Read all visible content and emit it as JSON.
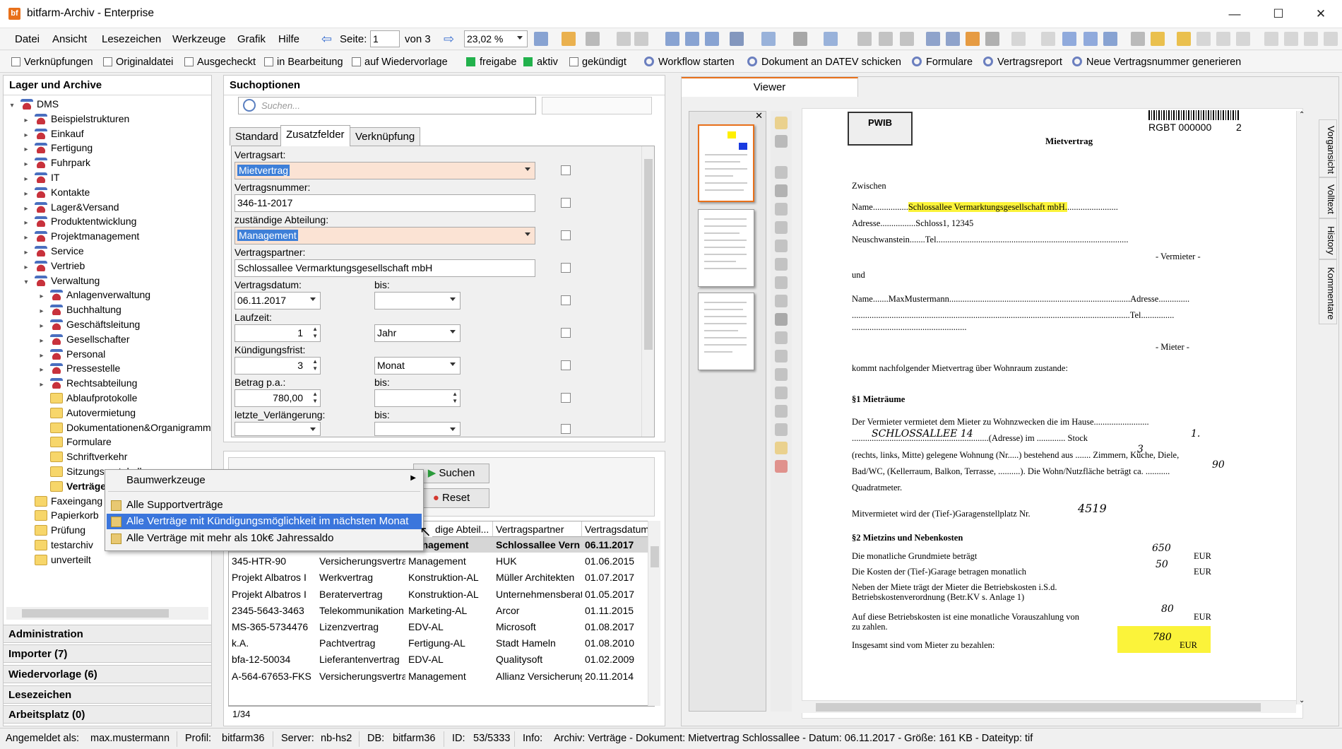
{
  "window": {
    "title": "bitfarm-Archiv - Enterprise",
    "app_icon": "bf"
  },
  "menu": [
    "Datei",
    "Ansicht",
    "Lesezeichen",
    "Werkzeuge",
    "Grafik",
    "Hilfe"
  ],
  "nav": {
    "page_label": "Seite:",
    "page_value": "1",
    "of_label": "von 3",
    "zoom": "23,02 %"
  },
  "filters": {
    "checks": [
      "Verknüpfungen",
      "Originaldatei",
      "Ausgecheckt",
      "in Bearbeitung",
      "auf Wiedervorlage"
    ],
    "status": [
      "freigabe",
      "aktiv"
    ],
    "gekuendigt": "gekündigt",
    "actions": [
      "Workflow starten",
      "Dokument an DATEV schicken",
      "Formulare",
      "Vertragsreport",
      "Neue Vertragsnummer generieren"
    ]
  },
  "left": {
    "header": "Lager und Archive",
    "root": "DMS",
    "top_items": [
      "Beispielstrukturen",
      "Einkauf",
      "Fertigung",
      "Fuhrpark",
      "IT",
      "Kontakte",
      "Lager&Versand",
      "Produktentwicklung",
      "Projektmanagement",
      "Service",
      "Vertrieb",
      "Verwaltung"
    ],
    "verwaltung_red": [
      "Anlagenverwaltung",
      "Buchhaltung",
      "Geschäftsleitung",
      "Gesellschafter",
      "Personal",
      "Pressestelle",
      "Rechtsabteilung"
    ],
    "verwaltung_yellow": [
      "Ablaufprotokolle",
      "Autovermietung",
      "Dokumentationen&Organigramm",
      "Formulare",
      "Schriftverkehr",
      "Sitzungsprotokolle",
      "Verträge"
    ],
    "bottom_items": [
      "Faxeingang",
      "Papierkorb",
      "Prüfung",
      "testarchiv",
      "unverteilt"
    ],
    "accordion": [
      "Administration",
      "Importer (7)",
      "Wiedervorlage (6)",
      "Lesezeichen",
      "Arbeitsplatz (0)"
    ]
  },
  "search": {
    "header": "Suchoptionen",
    "placeholder": "Suchen...",
    "tabs": [
      "Standard",
      "Zusatzfelder",
      "Verknüpfung"
    ],
    "fields": {
      "vertragsart_label": "Vertragsart:",
      "vertragsart": "Mietvertrag",
      "vertragsnummer_label": "Vertragsnummer:",
      "vertragsnummer": "346-11-2017",
      "abteilung_label": "zuständige Abteilung:",
      "abteilung": "Management",
      "partner_label": "Vertragspartner:",
      "partner": "Schlossallee Vermarktungsgesellschaft mbH",
      "datum_label": "Vertragsdatum:",
      "datum": "06.11.2017",
      "bis": "bis:",
      "laufzeit_label": "Laufzeit:",
      "laufzeit": "1",
      "laufzeit_unit": "Jahr",
      "kuendigung_label": "Kündigungsfrist:",
      "kuendigung": "3",
      "kuendigung_unit": "Monat",
      "betrag_label": "Betrag p.a.:",
      "betrag": "780,00",
      "verlaengerung_label": "letzte_Verlängerung:"
    },
    "buttons": {
      "search": "Suchen",
      "reset": "Reset"
    }
  },
  "results": {
    "headers": [
      "dige Abteil...",
      "Vertragspartner",
      "Vertragsdatum"
    ],
    "rows": [
      [
        "",
        "",
        "Management",
        "Schlossallee Vern",
        "06.11.2017"
      ],
      [
        "345-HTR-90",
        "Versicherungsvertra",
        "Management",
        "HUK",
        "01.06.2015"
      ],
      [
        "Projekt Albatros I",
        "Werkvertrag",
        "Konstruktion-AL",
        "Müller Architekten",
        "01.07.2017"
      ],
      [
        "Projekt Albatros I",
        "Beratervertrag",
        "Konstruktion-AL",
        "Unternehmensberat",
        "01.05.2017"
      ],
      [
        "2345-5643-3463",
        "Telekommunikation",
        "Marketing-AL",
        "Arcor",
        "01.11.2015"
      ],
      [
        "MS-365-5734476",
        "Lizenzvertrag",
        "EDV-AL",
        "Microsoft",
        "01.08.2017"
      ],
      [
        "k.A.",
        "Pachtvertrag",
        "Fertigung-AL",
        "Stadt Hameln",
        "01.08.2010"
      ],
      [
        "bfa-12-50034",
        "Lieferantenvertrag",
        "EDV-AL",
        "Qualitysoft",
        "01.02.2009"
      ],
      [
        "A-564-67653-FKS",
        "Versicherungsvertra",
        "Management",
        "Allianz Versicherungs",
        "20.11.2014"
      ]
    ],
    "count": "1/34"
  },
  "context_menu": {
    "tools": "Baumwerkzeuge",
    "items": [
      "Alle Supportverträge",
      "Alle Verträge mit Kündigungsmöglichkeit im nächsten Monat",
      "Alle Verträge mit mehr als 10k€ Jahressaldo"
    ]
  },
  "viewer": {
    "tab": "Viewer",
    "side_tabs": [
      "Vorgansicht",
      "Volltext",
      "History",
      "Kommentare"
    ],
    "doc": {
      "logo": "PWIB",
      "code": "RGBT 000000",
      "page_no": "2",
      "title": "Mietvertrag",
      "zwischen": "Zwischen",
      "name1_label": "Name................",
      "name1": "Schlossallee Vermarktungsgesellschaft mbH.",
      "adresse1": "Adresse................Schloss1, 12345",
      "ort1": "Neuschwanstein.......Tel.......................................................................................",
      "vermieter": "- Vermieter -",
      "und": "und",
      "name2": "Name.......MaxMustermann..................................................................................Adresse..............",
      "line2": "..............................................................................................................................Tel...............",
      "line3": "....................................................",
      "mieter": "- Mieter -",
      "intro": "kommt nachfolgender Mietvertrag über Wohnraum zustande:",
      "s1": "§1 Mieträume",
      "s1a": "Der  Vermieter  vermietet  dem  Mieter  zu  Wohnzwecken     die  im  Hause.........................",
      "s1b": "..............................................................(Adresse)   im   .............   Stock",
      "s1c": "(rechts, links, Mitte) gelegene Wohnung (Nr.....) bestehend aus .......  Zimmern, Küche, Diele,",
      "s1d": "Bad/WC, (Kellerraum, Balkon, Terrasse, ..........). Die Wohn/Nutzfläche beträgt ca. ...........",
      "s1e": "Quadratmeter.",
      "garage": "Mitvermietet wird der (Tief-)Garagenstellplatz Nr.",
      "hw_addr": "SCHLOSSALLEE 14",
      "hw_floor": "1.",
      "hw_rooms": "3",
      "hw_area": "90",
      "hw_garage": "4519",
      "s2": "§2 Mietzins und Nebenkosten",
      "s2a": "Die monatliche Grundmiete beträgt",
      "s2a_v": "650",
      "s2b": "Die Kosten der (Tief-)Garage betragen monatlich",
      "s2b_v": "50",
      "s2c": "Neben der Miete trägt der Mieter die Betriebskosten i.S.d.",
      "s2d": "Betriebskostenverordnung (Betr.KV  s. Anlage 1)",
      "s2e": "Auf diese Betriebskosten ist eine monatliche Vorauszahlung von",
      "s2e_v": "80",
      "s2f": "zu zahlen.",
      "s2g": "Insgesamt sind vom Mieter zu bezahlen:",
      "s2g_v": "780",
      "eur": "EUR"
    }
  },
  "status": {
    "user_label": "Angemeldet als:",
    "user": "max.mustermann",
    "profil_label": "Profil:",
    "profil": "bitfarm36",
    "server_label": "Server:",
    "server": "nb-hs2",
    "db_label": "DB:",
    "db": "bitfarm36",
    "id_label": "ID:",
    "id": "53/5333",
    "info_label": "Info:",
    "info": "Archiv: Verträge - Dokument: Mietvertrag Schlossallee - Datum: 06.11.2017 - Größe: 161 KB - Dateityp: tif"
  }
}
